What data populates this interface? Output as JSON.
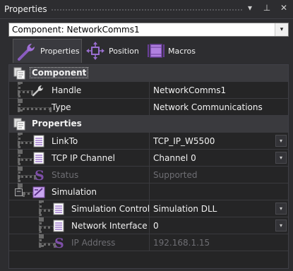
{
  "panel": {
    "title": "Properties",
    "buttons": [
      "▾",
      "⊥",
      "✕"
    ]
  },
  "component_select": {
    "value": "Component: NetworkComms1",
    "arrow": "▾"
  },
  "tabs": [
    {
      "label": "Properties",
      "icon": "wrench-icon"
    },
    {
      "label": "Position",
      "icon": "move-arrows-icon"
    },
    {
      "label": "Macros",
      "icon": "macro-icon"
    }
  ],
  "grid": {
    "component_category": "Component",
    "handle": {
      "name": "Handle",
      "value": "NetworkComms1",
      "icon": "wrench-icon"
    },
    "type": {
      "name": "Type",
      "value": "Network Communications"
    },
    "properties_category": "Properties",
    "linkto": {
      "name": "LinkTo",
      "value": "TCP_IP_W5500",
      "icon": "document-icon"
    },
    "tcp_channel": {
      "name": "TCP IP Channel",
      "value": "Channel 0",
      "icon": "document-icon"
    },
    "status": {
      "name": "Status",
      "value": "Supported",
      "icon": "s-icon"
    },
    "simulation": {
      "name": "Simulation",
      "expander": "−",
      "icon": "simulation-icon"
    },
    "sim_control": {
      "name": "Simulation Control",
      "value": "Simulation DLL",
      "icon": "document-icon"
    },
    "net_interface": {
      "name": "Network Interface",
      "value": "0",
      "icon": "document-icon"
    },
    "ip_address": {
      "name": "IP Address",
      "value": "192.168.1.15",
      "icon": "s-icon"
    }
  },
  "colors": {
    "background": "#2d2d30",
    "grid_bg": "#252526",
    "category_bg": "#3a3a3e",
    "dim_text": "#6e6e73",
    "icon_purple": "#7e4fa8"
  }
}
